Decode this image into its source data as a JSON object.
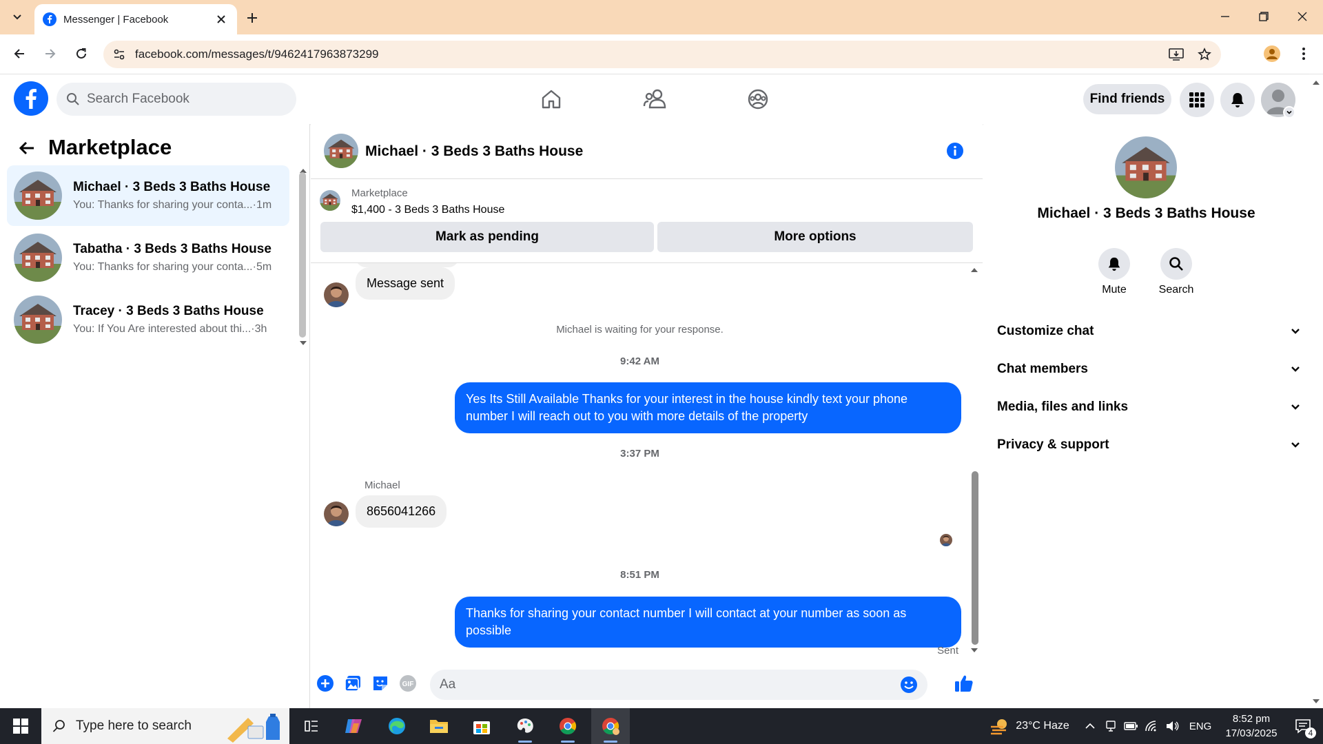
{
  "browser": {
    "tab_title": "Messenger | Facebook",
    "url": "facebook.com/messages/t/9462417963873299"
  },
  "fb": {
    "search_placeholder": "Search Facebook",
    "find_friends": "Find friends"
  },
  "left": {
    "title": "Marketplace",
    "conversations": [
      {
        "name": "Michael · 3 Beds 3 Baths House",
        "preview": "You: Thanks for sharing your conta...",
        "time": "·1m",
        "active": true
      },
      {
        "name": "Tabatha · 3 Beds 3 Baths House",
        "preview": "You: Thanks for sharing your conta...",
        "time": "·5m",
        "active": false
      },
      {
        "name": "Tracey · 3 Beds 3 Baths House",
        "preview": "You: If You Are interested about thi...",
        "time": "·3h",
        "active": false
      }
    ]
  },
  "chat": {
    "title": "Michael · 3 Beds 3 Baths House",
    "listing_category": "Marketplace",
    "listing_price": "$1,400 - 3 Beds 3 Baths House",
    "mark_pending": "Mark as pending",
    "more_options": "More options",
    "msg_sent": "Message sent",
    "waiting": "Michael is waiting for your response.",
    "time1": "9:42 AM",
    "out1": "Yes Its Still Available Thanks for your interest in the house kindly text your phone number I will reach out to you with more details of the property",
    "time2": "3:37 PM",
    "sender": "Michael",
    "in_phone": "8656041266",
    "time3": "8:51 PM",
    "out2": "Thanks for sharing your contact number I will contact at your number as soon as possible",
    "status": "Sent",
    "input_placeholder": "Aa",
    "accent": "#0866ff"
  },
  "right": {
    "title": "Michael · 3 Beds 3 Baths House",
    "mute": "Mute",
    "search": "Search",
    "sections": [
      "Customize chat",
      "Chat members",
      "Media, files and links",
      "Privacy & support"
    ]
  },
  "taskbar": {
    "search_placeholder": "Type here to search",
    "weather": "23°C  Haze",
    "lang": "ENG",
    "time": "8:52 pm",
    "date": "17/03/2025",
    "notif_count": "4"
  }
}
